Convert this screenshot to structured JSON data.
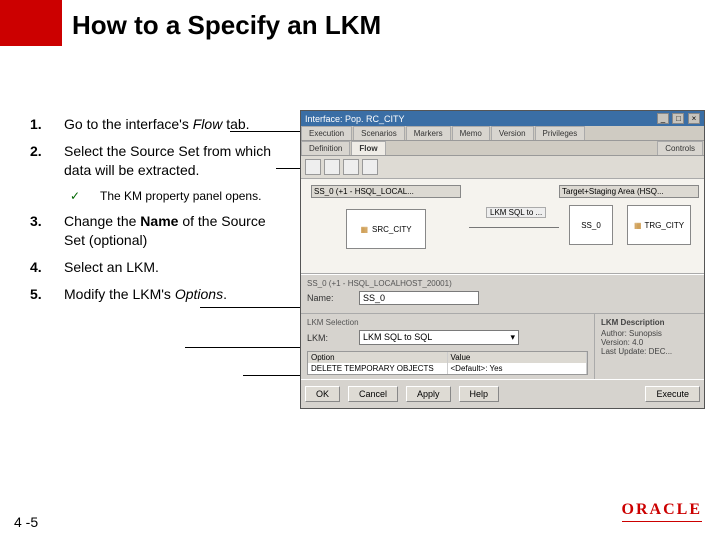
{
  "slide": {
    "title": "How to a Specify an LKM",
    "page": "4 -5",
    "logo": "ORACLE"
  },
  "steps": {
    "s1": {
      "num": "1.",
      "pre": "Go to the interface's ",
      "em": "Flow",
      "post": " tab."
    },
    "s2": {
      "num": "2.",
      "text": "Select the Source Set from which data will be extracted."
    },
    "s2a": {
      "tick": "✓",
      "text": "The KM property panel opens."
    },
    "s3": {
      "num": "3.",
      "pre": "Change the ",
      "b": "Name",
      "post": " of the Source Set  (optional)"
    },
    "s4": {
      "num": "4.",
      "text": "Select an LKM."
    },
    "s5": {
      "num": "5.",
      "pre": "Modify the LKM's ",
      "em": "Options",
      "post": "."
    }
  },
  "app": {
    "win_title": "Interface: Pop.  RC_CITY",
    "tabs_top": [
      "Execution",
      "Scenarios",
      "Markers",
      "Memo",
      "Version",
      "Privileges"
    ],
    "tabs_sub": {
      "left": "Definition",
      "active": "Flow",
      "right": "Controls"
    },
    "diagram": {
      "source_header": "SS_0  (+1 - HSQL_LOCAL...",
      "source_body": "SRC_CITY",
      "lkm_label": "LKM SQL to ...",
      "target_header": "Target+Staging Area (HSQ...",
      "target_body1": "SS_0",
      "target_body2": "TRG_CITY"
    },
    "prop": {
      "header": "SS_0 (+1 - HSQL_LOCALHOST_20001)",
      "name_label": "Name:",
      "name_value": "SS_0",
      "lkm_section": "LKM Selection",
      "lkm_label": "LKM:",
      "lkm_value": "LKM SQL to SQL",
      "desc_title": "LKM Description",
      "desc_lines": [
        "Author: Sunopsis",
        "Version: 4.0",
        "Last Update: DEC..."
      ]
    },
    "options": {
      "col_option": "Option",
      "col_value": "Value",
      "opt_name": "DELETE TEMPORARY OBJECTS",
      "opt_value": "<Default>: Yes"
    },
    "buttons": {
      "ok": "OK",
      "cancel": "Cancel",
      "apply": "Apply",
      "help": "Help",
      "execute": "Execute"
    }
  }
}
